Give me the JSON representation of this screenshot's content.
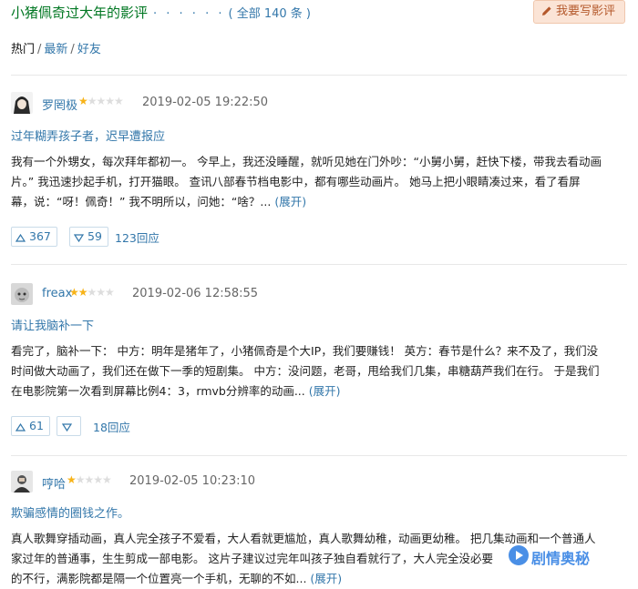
{
  "header": {
    "title": "小猪佩奇过大年的影评",
    "dots": "· · · · · ·",
    "count": "( 全部 140 条 )",
    "write_button": "我要写影评"
  },
  "sort": {
    "hot": "热门",
    "sep": "/",
    "latest": "最新",
    "friends": "好友"
  },
  "reviews": [
    {
      "author": "罗罔极",
      "rating": 1,
      "time": "2019-02-05 19:22:50",
      "title": "过年糊弄孩子者，迟早遭报应",
      "lines": [
        "我有一个外甥女，每次拜年都初一。 今早上，我还没睡醒，就听见她在门外吵：“小舅小舅，赶快下楼，带我去看动画",
        "片。” 我迅速抄起手机，打开猫眼。 查讯八部春节档电影中，都有哪些动画片。 她马上把小眼睛凑过来，看了看屏",
        "幕，说：“呀！佩奇！” 我不明所以，问她：“啥？..."
      ],
      "expand": "(展开)",
      "up": "367",
      "down": "59",
      "replies": "123回应"
    },
    {
      "author": "freax",
      "rating": 2,
      "time": "2019-02-06 12:58:55",
      "title": "请让我脑补一下",
      "lines": [
        "看完了，脑补一下： 中方：明年是猪年了，小猪佩奇是个大IP，我们要赚钱！ 英方：春节是什么？来不及了，我们没",
        "时间做大动画了，我们还在做下一季的短剧集。 中方：没问题，老哥，甩给我们几集，串糖葫芦我们在行。 于是我们",
        "在电影院第一次看到屏幕比例4：3，rmvb分辨率的动画..."
      ],
      "expand": "(展开)",
      "up": "61",
      "down": "",
      "replies": "18回应"
    },
    {
      "author": "哼哈",
      "rating": 1,
      "time": "2019-02-05 10:23:10",
      "title": "欺骗感情的圈钱之作。",
      "lines": [
        "真人歌舞穿插动画，真人完全孩子不爱看，大人看就更尴尬，真人歌舞幼稚，动画更幼稚。 把几集动画和一个普通人",
        "家过年的普通事，生生剪成一部电影。 这片子建议过完年叫孩子独自看就行了，大人完全没必要",
        "的不行，满影院都是隔一个位置亮一个手机，无聊的不如..."
      ],
      "expand": "(展开)",
      "up": "",
      "down": "",
      "replies": ""
    }
  ],
  "watermark": "剧情奥秘",
  "colors": {
    "link": "#3377aa",
    "title_green": "#007722",
    "star": "#f7b318",
    "button_bg": "#fbe4d6"
  }
}
